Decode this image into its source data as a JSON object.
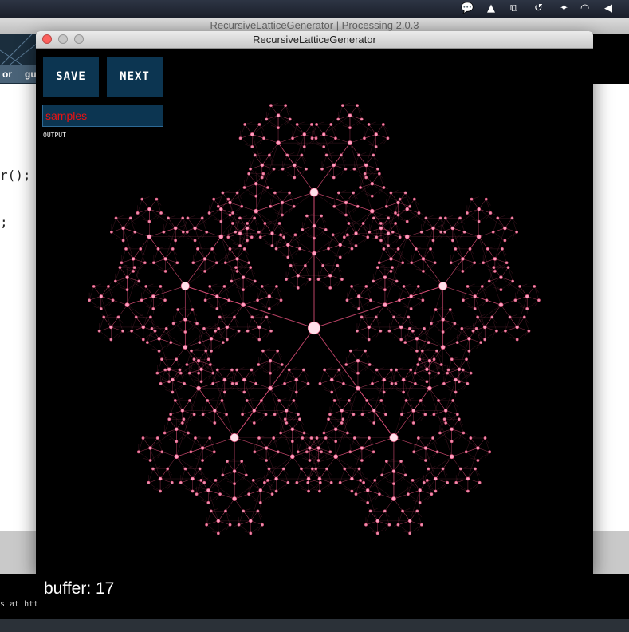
{
  "ide": {
    "title": "RecursiveLatticeGenerator | Processing 2.0.3",
    "tabs": [
      "or",
      "gu"
    ],
    "code_lines": [
      "r();",
      ";"
    ],
    "console_text": "s at htt"
  },
  "sketch_window": {
    "title": "RecursiveLatticeGenerator",
    "buttons": {
      "save": "SAVE",
      "next": "NEXT"
    },
    "output_field": {
      "value": "samples",
      "label": "OUTPUT"
    }
  },
  "status": {
    "buffer": "buffer: 17"
  },
  "colors": {
    "background": "#000000",
    "button": "#0c3551",
    "field_text": "#ee1111",
    "lattice_line": "#e0507a",
    "node_fill": "#ffe0ea",
    "node_glow": "#ff9ec0"
  },
  "menubar_icons": [
    "hangouts-icon",
    "hat-icon",
    "sync-icon",
    "time-machine-icon",
    "bluetooth-icon",
    "wifi-icon",
    "volume-icon"
  ]
}
